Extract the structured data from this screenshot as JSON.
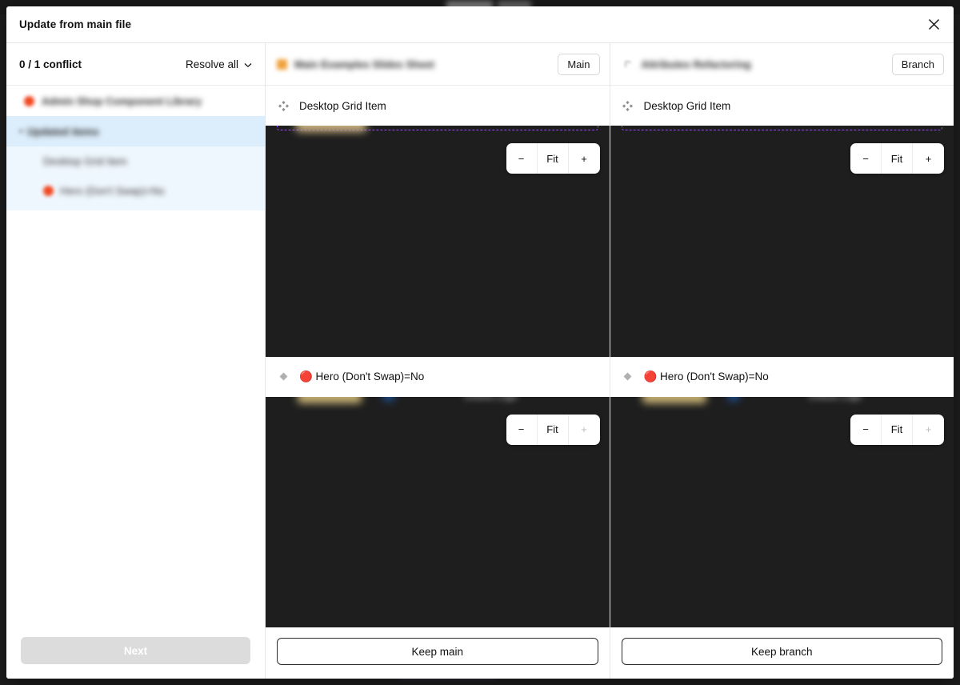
{
  "dialog": {
    "title": "Update from main file",
    "close_icon": "close-icon"
  },
  "sidebar": {
    "conflict_count": "0 / 1 conflict",
    "resolve_all_label": "Resolve all",
    "resolve_all_icon": "chevron-down-icon",
    "file_row": {
      "icon": "figma-file-icon",
      "label": "Admin Shop Component Library"
    },
    "group": {
      "label": "Updated items",
      "items": [
        {
          "icon": "component-icon",
          "label": "Desktop Grid Item"
        },
        {
          "icon": "red-circle-icon",
          "label": "Hero (Don't Swap)=No"
        }
      ]
    },
    "next_label": "Next",
    "next_disabled": true
  },
  "panels": [
    {
      "id": "main",
      "file_icon": "figma-file-icon",
      "file_name": "Main Examples Slides Sheet",
      "badge": "Main",
      "layers": [
        {
          "icon": "component-icon",
          "label": "Desktop Grid Item"
        },
        {
          "icon": "instance-icon",
          "label": "🔴 Hero (Don't Swap)=No"
        }
      ],
      "zoom_controls": {
        "minus_label": "−",
        "fit_label": "Fit",
        "plus_label": "+",
        "minus_disabled": false,
        "plus_disabled": false
      },
      "zoom_controls_lower": {
        "minus_label": "−",
        "fit_label": "Fit",
        "plus_label": "+",
        "minus_disabled": false,
        "plus_disabled": true
      },
      "keep_label": "Keep main"
    },
    {
      "id": "branch",
      "file_icon": "figma-file-icon",
      "file_name": "Attributes Refactoring",
      "badge": "Branch",
      "layers": [
        {
          "icon": "component-icon",
          "label": "Desktop Grid Item"
        },
        {
          "icon": "instance-icon",
          "label": "🔴 Hero (Don't Swap)=No"
        }
      ],
      "zoom_controls": {
        "minus_label": "−",
        "fit_label": "Fit",
        "plus_label": "+",
        "minus_disabled": false,
        "plus_disabled": false
      },
      "zoom_controls_lower": {
        "minus_label": "−",
        "fit_label": "Fit",
        "plus_label": "+",
        "minus_disabled": false,
        "plus_disabled": true
      },
      "keep_label": "Keep branch"
    }
  ],
  "colors": {
    "canvas_dark": "#1e1e1e",
    "selection_purple": "#9747ff",
    "highlight_blue": "#dcedfb",
    "red_dot": "#f24822",
    "orange_icon": "#f0a13c",
    "disabled_grey": "#dcdcdc"
  }
}
